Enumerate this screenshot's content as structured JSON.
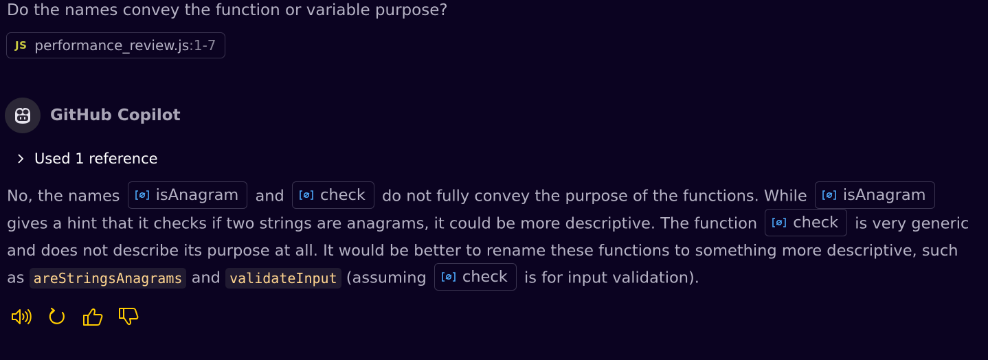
{
  "question": "Do the names convey the function or variable purpose?",
  "file_ref": {
    "badge": "JS",
    "name": "performance_review.js",
    "range": ":1-7"
  },
  "author": "GitHub Copilot",
  "references_toggle": "Used 1 reference",
  "answer": {
    "t1": "No, the names",
    "sym1": "isAnagram",
    "t2": "and",
    "sym2": "check",
    "t3": "do not fully convey the purpose of the functions. While",
    "sym3": "isAnagram",
    "t4": "gives a hint that it checks if two strings are anagrams, it could be more descriptive. The function",
    "sym4": "check",
    "t5": "is very generic and does not describe its purpose at all. It would be better to rename these functions to something more descriptive, such as",
    "code1": "areStringsAnagrams",
    "t6": "and",
    "code2": "validateInput",
    "t7": "(assuming",
    "sym5": "check",
    "t8": "is for input validation)."
  },
  "actions": [
    "speaker-icon",
    "retry-icon",
    "thumbs-up-icon",
    "thumbs-down-icon"
  ],
  "colors": {
    "background": "#0b0321",
    "text": "#b5b2c4",
    "accent_icon": "#ffcc00",
    "symbol_icon": "#4daafc",
    "code_text": "#ffd58f",
    "js_badge": "#cbcb41"
  }
}
